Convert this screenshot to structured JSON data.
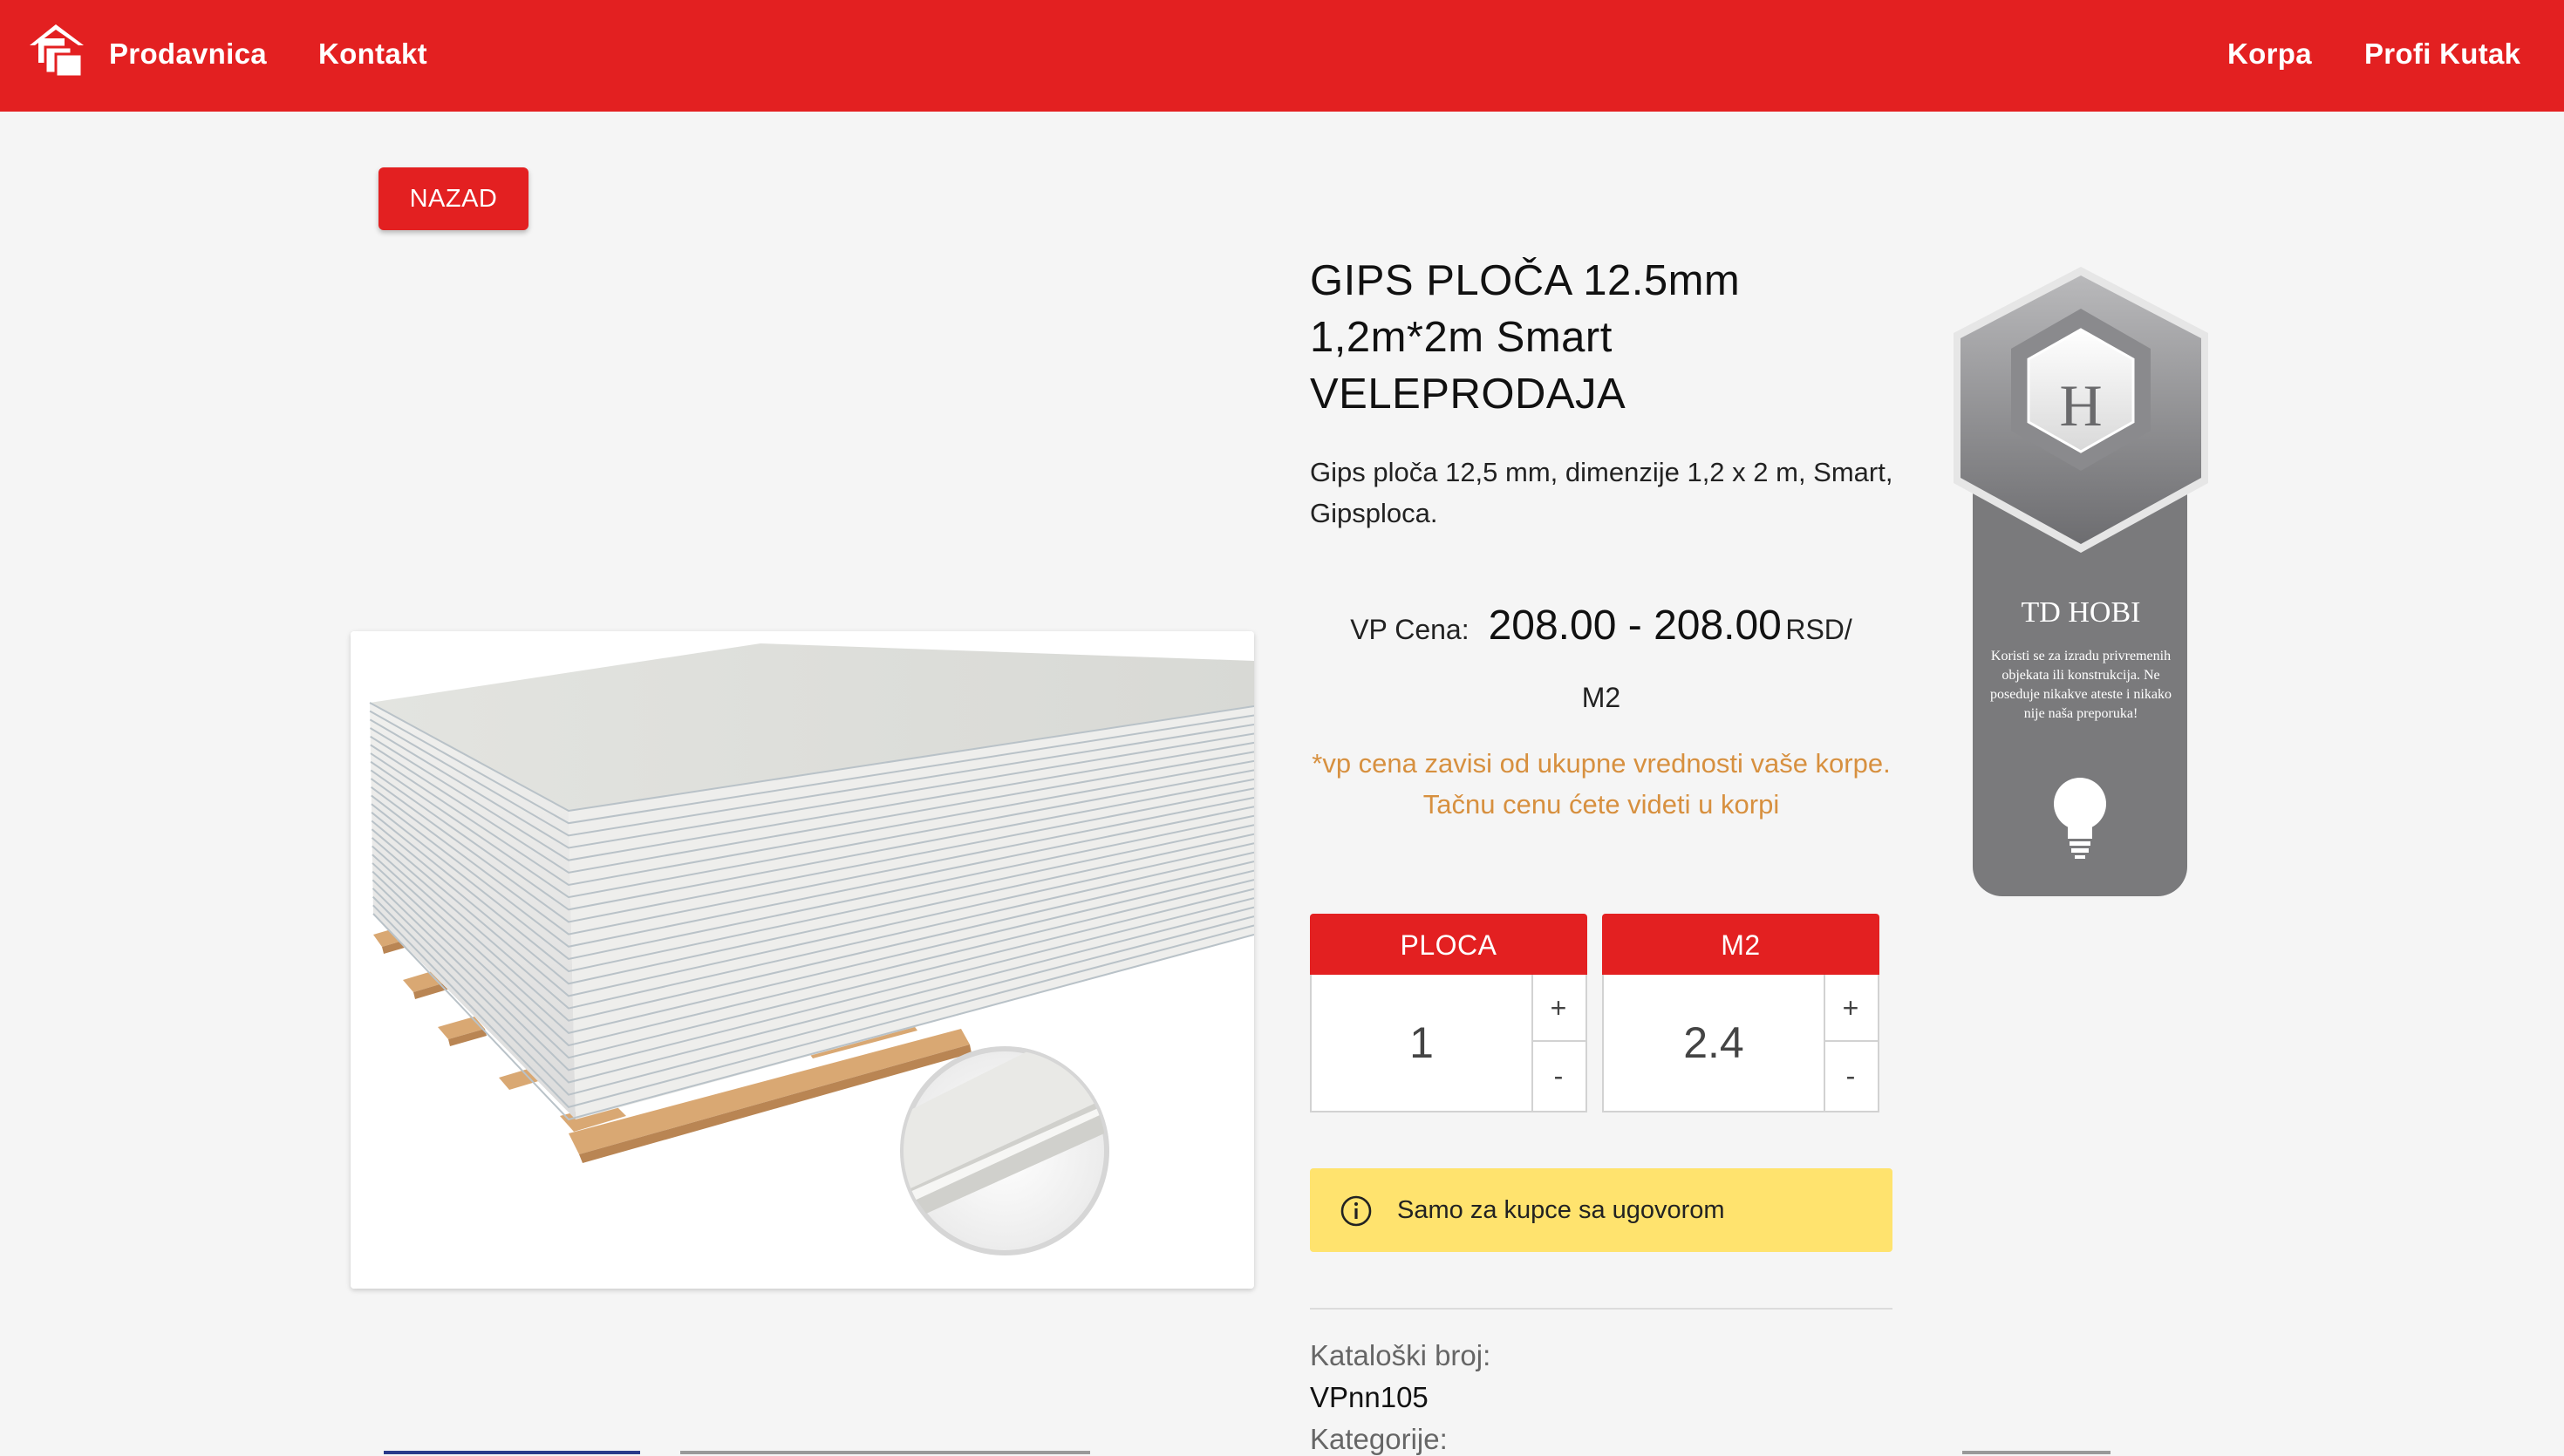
{
  "nav": {
    "shop": "Prodavnica",
    "contact": "Kontakt",
    "cart": "Korpa",
    "pro_corner": "Profi Kutak"
  },
  "back_label": "NAZAD",
  "product": {
    "title": "GIPS PLOČA 12.5mm 1,2m*2m Smart VELEPRODAJA",
    "description": "Gips ploča 12,5 mm, dimenzije 1,2 x 2 m, Smart, Gipsploca.",
    "price_label": "VP Cena:",
    "price_value": "208.00 - 208.00",
    "price_currency": "RSD/",
    "price_unit": "M2",
    "price_note": "*vp cena zavisi od ukupne vrednosti vaše korpe. Tačnu cenu ćete videti u korpi"
  },
  "quantity": {
    "plate_label": "PLOCA",
    "plate_value": "1",
    "m2_label": "M2",
    "m2_value": "2.4",
    "plus": "+",
    "minus": "-"
  },
  "notice_text": "Samo za kupce sa ugovorom",
  "meta": {
    "catalog_label": "Kataloški broj:",
    "catalog_value": "VPnn105",
    "category_label": "Kategorije:"
  },
  "badge": {
    "letter": "H",
    "title": "TD HOBI",
    "text": "Koristi se za izradu privremenih objekata ili konstrukcija. Ne poseduje nikakve ateste i nikako nije naša preporuka!"
  },
  "colors": {
    "brand_red": "#e32021",
    "note_orange": "#d7903f",
    "notice_yellow": "#ffe36e",
    "badge_gray": "#7a7a7c"
  }
}
